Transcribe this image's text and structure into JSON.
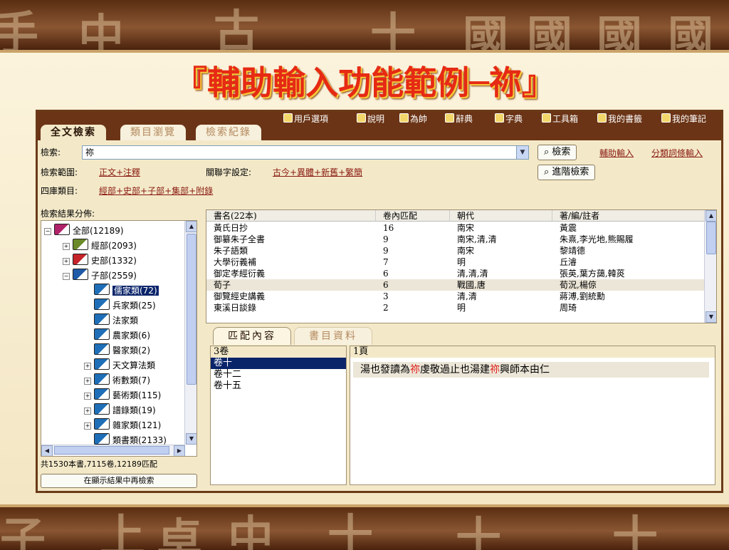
{
  "slide_title": "『輔助輸入功能範例─祢』",
  "banner": {
    "top_glyphs": [
      "手",
      "中",
      "古",
      "十",
      "國",
      "國",
      "國",
      "國"
    ],
    "bottom_glyphs": [
      "子",
      "上",
      "卓",
      "中",
      "十",
      "十",
      "十"
    ]
  },
  "toolbar": {
    "items": [
      "用戶選項",
      "說明",
      "為帥",
      "辭典",
      "字典",
      "工具箱",
      "我的書籤",
      "我的筆記"
    ]
  },
  "tabs": [
    "全文檢索",
    "類目瀏覽",
    "檢索紀錄"
  ],
  "search": {
    "label": "檢索:",
    "value": "祢",
    "button": "檢索",
    "advanced_button": "進階檢索",
    "assist_link": "輔助輸入",
    "category_link": "分類詞條輸入"
  },
  "range": {
    "label": "檢索範圍:",
    "value": "正文+注釋"
  },
  "related": {
    "label": "關聯字設定:",
    "value": "古今+異體+新舊+繁簡"
  },
  "siku": {
    "label": "四庫類目:",
    "value": "經部+史部+子部+集部+附錄"
  },
  "distribution_label": "檢索結果分佈:",
  "tree": [
    {
      "label": "全部(12189)",
      "level": 0,
      "exp": "−"
    },
    {
      "label": "經部(2093)",
      "level": 1,
      "exp": "+"
    },
    {
      "label": "史部(1332)",
      "level": 1,
      "exp": "+"
    },
    {
      "label": "子部(2559)",
      "level": 1,
      "exp": "−"
    },
    {
      "label": "儒家類(72)",
      "level": 2,
      "exp": "",
      "selected": true
    },
    {
      "label": "兵家類(25)",
      "level": 2,
      "exp": ""
    },
    {
      "label": "法家類",
      "level": 2,
      "exp": ""
    },
    {
      "label": "農家類(6)",
      "level": 2,
      "exp": ""
    },
    {
      "label": "醫家類(2)",
      "level": 2,
      "exp": ""
    },
    {
      "label": "天文算法類",
      "level": 2,
      "exp": "+"
    },
    {
      "label": "術數類(7)",
      "level": 2,
      "exp": "+"
    },
    {
      "label": "藝術類(115)",
      "level": 2,
      "exp": "+"
    },
    {
      "label": "譜錄類(19)",
      "level": 2,
      "exp": "+"
    },
    {
      "label": "雜家類(121)",
      "level": 2,
      "exp": "+"
    },
    {
      "label": "類書類(2133)",
      "level": 2,
      "exp": ""
    }
  ],
  "summary": "共1530本書,7115卷,12189匹配",
  "research_button": "在顯示結果中再檢索",
  "table": {
    "headers": [
      "書名(22本)",
      "卷內匹配",
      "朝代",
      "著/編/註者"
    ],
    "rows": [
      [
        "黃氏日抄",
        "16",
        "南宋",
        "黃震"
      ],
      [
        "御纂朱子全書",
        "9",
        "南宋,清,清",
        "朱熹,李光地,熊賜履"
      ],
      [
        "朱子語類",
        "9",
        "南宋",
        "黎靖德"
      ],
      [
        "大學衍義補",
        "7",
        "明",
        "丘濬"
      ],
      [
        "御定孝經衍義",
        "6",
        "清,清,清",
        "張英,葉方藹,韓菼"
      ],
      [
        "荀子",
        "6",
        "戰國,唐",
        "荀況,楊倞"
      ],
      [
        "御覽經史講義",
        "3",
        "清,清",
        "蔣溥,劉統勳"
      ],
      [
        "東溪日談錄",
        "2",
        "明",
        "周琦"
      ]
    ]
  },
  "lower_tabs": [
    "匹配內容",
    "書目資料"
  ],
  "volumes": {
    "header": "3卷",
    "items": [
      "卷十",
      "卷十二",
      "卷十五"
    ]
  },
  "page_label": "1頁",
  "match_text": {
    "before": "湯也發讀為",
    "hit1": "祢",
    "middle": "虔敬過止也湯建",
    "hit2": "祢",
    "after": "興師本由仁"
  }
}
